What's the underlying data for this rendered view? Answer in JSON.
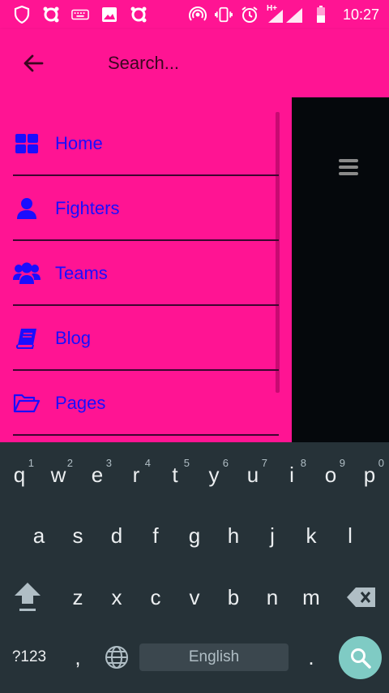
{
  "status_bar": {
    "time": "10:27",
    "left_icons": [
      "shield-icon",
      "app-icon",
      "keyboard-icon",
      "image-icon",
      "app-icon"
    ],
    "right_icons": [
      "hotspot-icon",
      "vibrate-icon",
      "alarm-icon",
      "signal-icon",
      "battery-icon"
    ],
    "network_label": "H+"
  },
  "search": {
    "placeholder": "Search..."
  },
  "drawer": {
    "items": [
      {
        "label": "Home",
        "icon": "grid-icon"
      },
      {
        "label": "Fighters",
        "icon": "person-icon"
      },
      {
        "label": "Teams",
        "icon": "group-icon"
      },
      {
        "label": "Blog",
        "icon": "book-icon"
      },
      {
        "label": "Pages",
        "icon": "folder-open-icon"
      }
    ]
  },
  "keyboard": {
    "row1": [
      {
        "k": "q",
        "h": "1"
      },
      {
        "k": "w",
        "h": "2"
      },
      {
        "k": "e",
        "h": "3"
      },
      {
        "k": "r",
        "h": "4"
      },
      {
        "k": "t",
        "h": "5"
      },
      {
        "k": "y",
        "h": "6"
      },
      {
        "k": "u",
        "h": "7"
      },
      {
        "k": "i",
        "h": "8"
      },
      {
        "k": "o",
        "h": "9"
      },
      {
        "k": "p",
        "h": "0"
      }
    ],
    "row2": [
      "a",
      "s",
      "d",
      "f",
      "g",
      "h",
      "j",
      "k",
      "l"
    ],
    "row3": [
      "z",
      "x",
      "c",
      "v",
      "b",
      "n",
      "m"
    ],
    "symbols_label": "?123",
    "comma": ",",
    "period": ".",
    "space_label": "English"
  },
  "colors": {
    "accent": "#ff1493",
    "menu_text": "#1a0dff",
    "keyboard_bg": "#263238",
    "search_key": "#7fcbc4"
  }
}
